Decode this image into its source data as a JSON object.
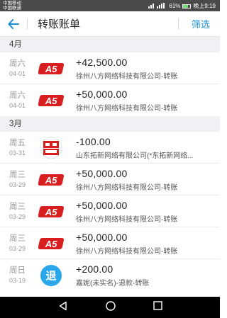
{
  "status_bar": {
    "carrier_1": "中国移动",
    "carrier_2": "中国联通",
    "battery": "61%",
    "time": "晚上9:19"
  },
  "header": {
    "title": "转账账单",
    "filter_label": "筛选",
    "back_icon": "arrow-left-icon"
  },
  "sections": [
    {
      "month": "4月",
      "items": [
        {
          "day": "周六",
          "date": "04-01",
          "logo": "a5-logo",
          "amount": "+42,500.00",
          "desc": "徐州八方网络科技有限公司-转账"
        },
        {
          "day": "周六",
          "date": "04-01",
          "logo": "a5-logo",
          "amount": "+50,000.00",
          "desc": "徐州八方网络科技有限公司-转账"
        }
      ]
    },
    {
      "month": "3月",
      "items": [
        {
          "day": "周五",
          "date": "03-31",
          "logo": "team-logo",
          "amount": "-100.00",
          "desc": "山东拓新网络有限公司(*东拓新网络..."
        },
        {
          "day": "周三",
          "date": "03-29",
          "logo": "a5-logo",
          "amount": "+50,000.00",
          "desc": "徐州八方网络科技有限公司-转账"
        },
        {
          "day": "周三",
          "date": "03-29",
          "logo": "a5-logo",
          "amount": "+50,000.00",
          "desc": "徐州八方网络科技有限公司-转账"
        },
        {
          "day": "周三",
          "date": "03-29",
          "logo": "a5-logo",
          "amount": "+50,000.00",
          "desc": "徐州八方网络科技有限公司-转账"
        },
        {
          "day": "周日",
          "date": "03-19",
          "logo": "refund-icon",
          "logo_text": "退",
          "amount": "+200.00",
          "desc": "嘉妮(未实名)-退款-转账"
        }
      ]
    }
  ],
  "colors": {
    "accent": "#1a8fd8",
    "a5_red": "#d81e1e",
    "refund_blue": "#2aa7ea"
  },
  "nav_icons": [
    "back-triangle-icon",
    "home-circle-icon",
    "recents-square-icon"
  ]
}
